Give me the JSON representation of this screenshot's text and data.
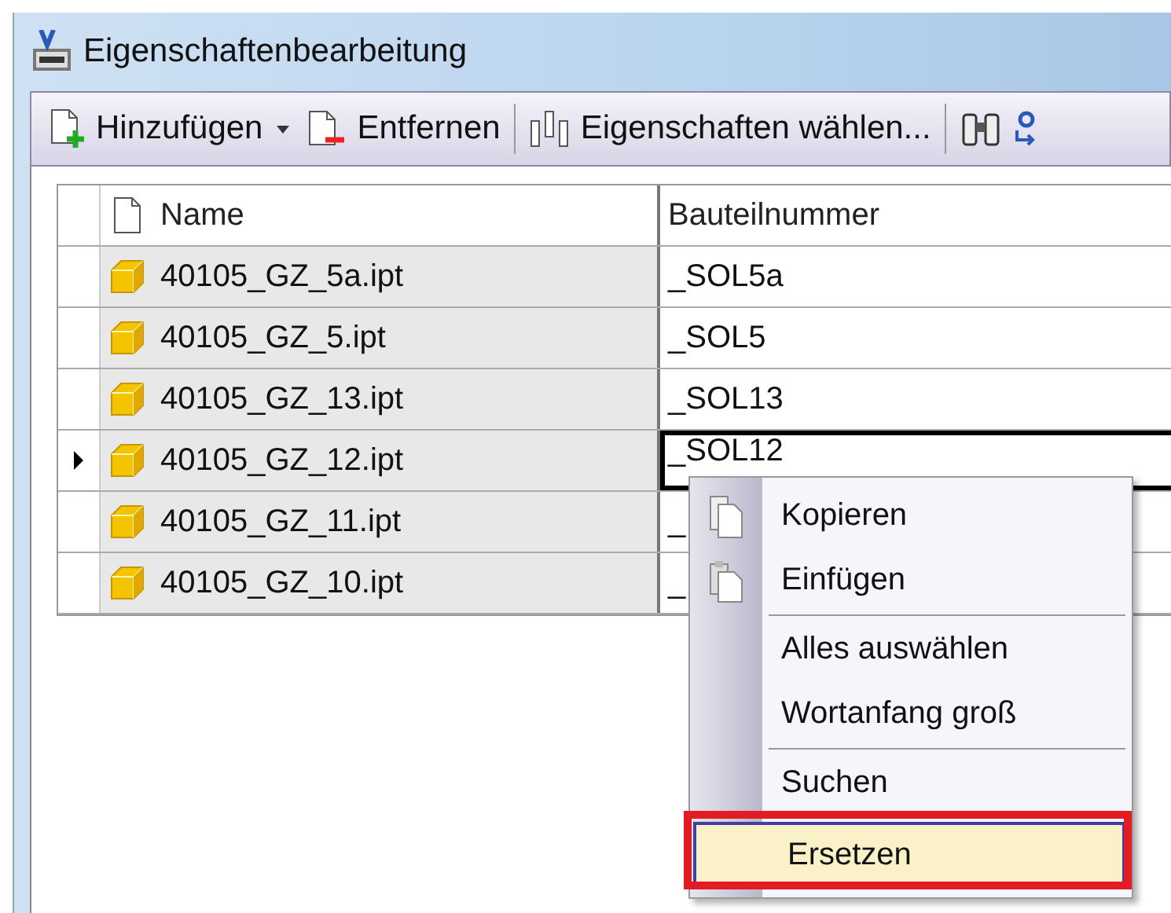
{
  "window": {
    "title": "Eigenschaftenbearbeitung"
  },
  "toolbar": [
    {
      "kind": "add",
      "label": "Hinzufügen"
    },
    {
      "kind": "remove",
      "label": "Entfernen"
    },
    {
      "kind": "properties",
      "label": "Eigenschaften wählen..."
    },
    {
      "kind": "find"
    },
    {
      "kind": "replace"
    }
  ],
  "table": {
    "columns": [
      "Name",
      "Bauteilnummer"
    ],
    "rows": [
      {
        "name": "40105_GZ_5a.ipt",
        "part_number": "_SOL5a",
        "current": false
      },
      {
        "name": "40105_GZ_5.ipt",
        "part_number": "_SOL5",
        "current": false
      },
      {
        "name": "40105_GZ_13.ipt",
        "part_number": "_SOL13",
        "current": false
      },
      {
        "name": "40105_GZ_12.ipt",
        "part_number": "_SOL12",
        "current": true
      },
      {
        "name": "40105_GZ_11.ipt",
        "part_number": "_",
        "current": false
      },
      {
        "name": "40105_GZ_10.ipt",
        "part_number": "_",
        "current": false
      }
    ]
  },
  "context_menu": {
    "items": [
      {
        "kind": "copy",
        "label": "Kopieren",
        "selected": false
      },
      {
        "kind": "paste",
        "label": "Einfügen",
        "selected": false
      },
      {
        "kind": "separator"
      },
      {
        "kind": "plain",
        "label": "Alles auswählen",
        "selected": false
      },
      {
        "kind": "plain",
        "label": "Wortanfang groß",
        "selected": false
      },
      {
        "kind": "separator"
      },
      {
        "kind": "plain",
        "label": "Suchen",
        "selected": false
      },
      {
        "kind": "plain",
        "label": "Ersetzen",
        "selected": true
      }
    ]
  }
}
